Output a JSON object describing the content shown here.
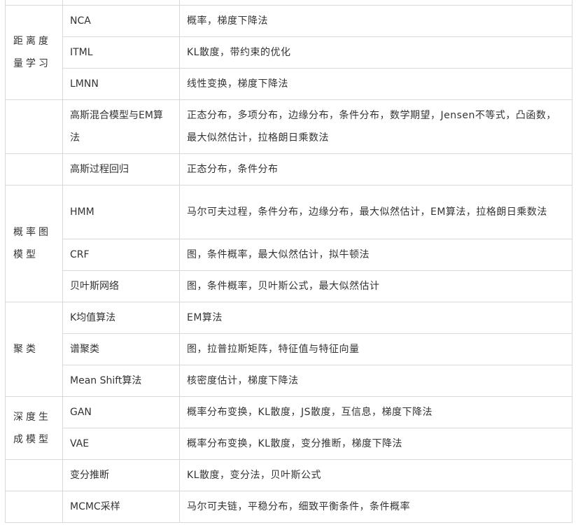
{
  "table": {
    "rows": [
      {
        "category": "",
        "model": "",
        "math": ""
      },
      {
        "category": "距离度量学习",
        "model": "NCA",
        "math": "概率，梯度下降法"
      },
      {
        "category": "",
        "model": "ITML",
        "math": "KL散度，带约束的优化"
      },
      {
        "category": "",
        "model": "LMNN",
        "math": "线性变换，梯度下降法"
      },
      {
        "category": "",
        "model": "高斯混合模型与EM算法",
        "math": "正态分布，多项分布，边缘分布，条件分布，数学期望，Jensen不等式，凸函数，最大似然估计，拉格朗日乘数法"
      },
      {
        "category": "",
        "model": "高斯过程回归",
        "math": "正态分布，条件分布"
      },
      {
        "category": "概率图模型",
        "model": "HMM",
        "math": "马尔可夫过程，条件分布，边缘分布，最大似然估计，EM算法，拉格朗日乘数法"
      },
      {
        "category": "",
        "model": "CRF",
        "math": "图，条件概率，最大似然估计，拟牛顿法"
      },
      {
        "category": "",
        "model": "贝叶斯网络",
        "math": "图，条件概率，贝叶斯公式，最大似然估计"
      },
      {
        "category": "聚类",
        "model": "K均值算法",
        "math": "EM算法"
      },
      {
        "category": "",
        "model": "谱聚类",
        "math": "图，拉普拉斯矩阵，特征值与特征向量"
      },
      {
        "category": "",
        "model": "Mean Shift算法",
        "math": "核密度估计，梯度下降法"
      },
      {
        "category": "深度生成模型",
        "model": "GAN",
        "math": "概率分布变换，KL散度，JS散度，互信息，梯度下降法"
      },
      {
        "category": "",
        "model": "VAE",
        "math": "概率分布变换，KL散度，变分推断，梯度下降法"
      },
      {
        "category": "",
        "model": "变分推断",
        "math": "KL散度，变分法，贝叶斯公式"
      },
      {
        "category": "",
        "model": "MCMC采样",
        "math": "马尔可夫链，平稳分布，细致平衡条件，条件概率"
      }
    ]
  }
}
